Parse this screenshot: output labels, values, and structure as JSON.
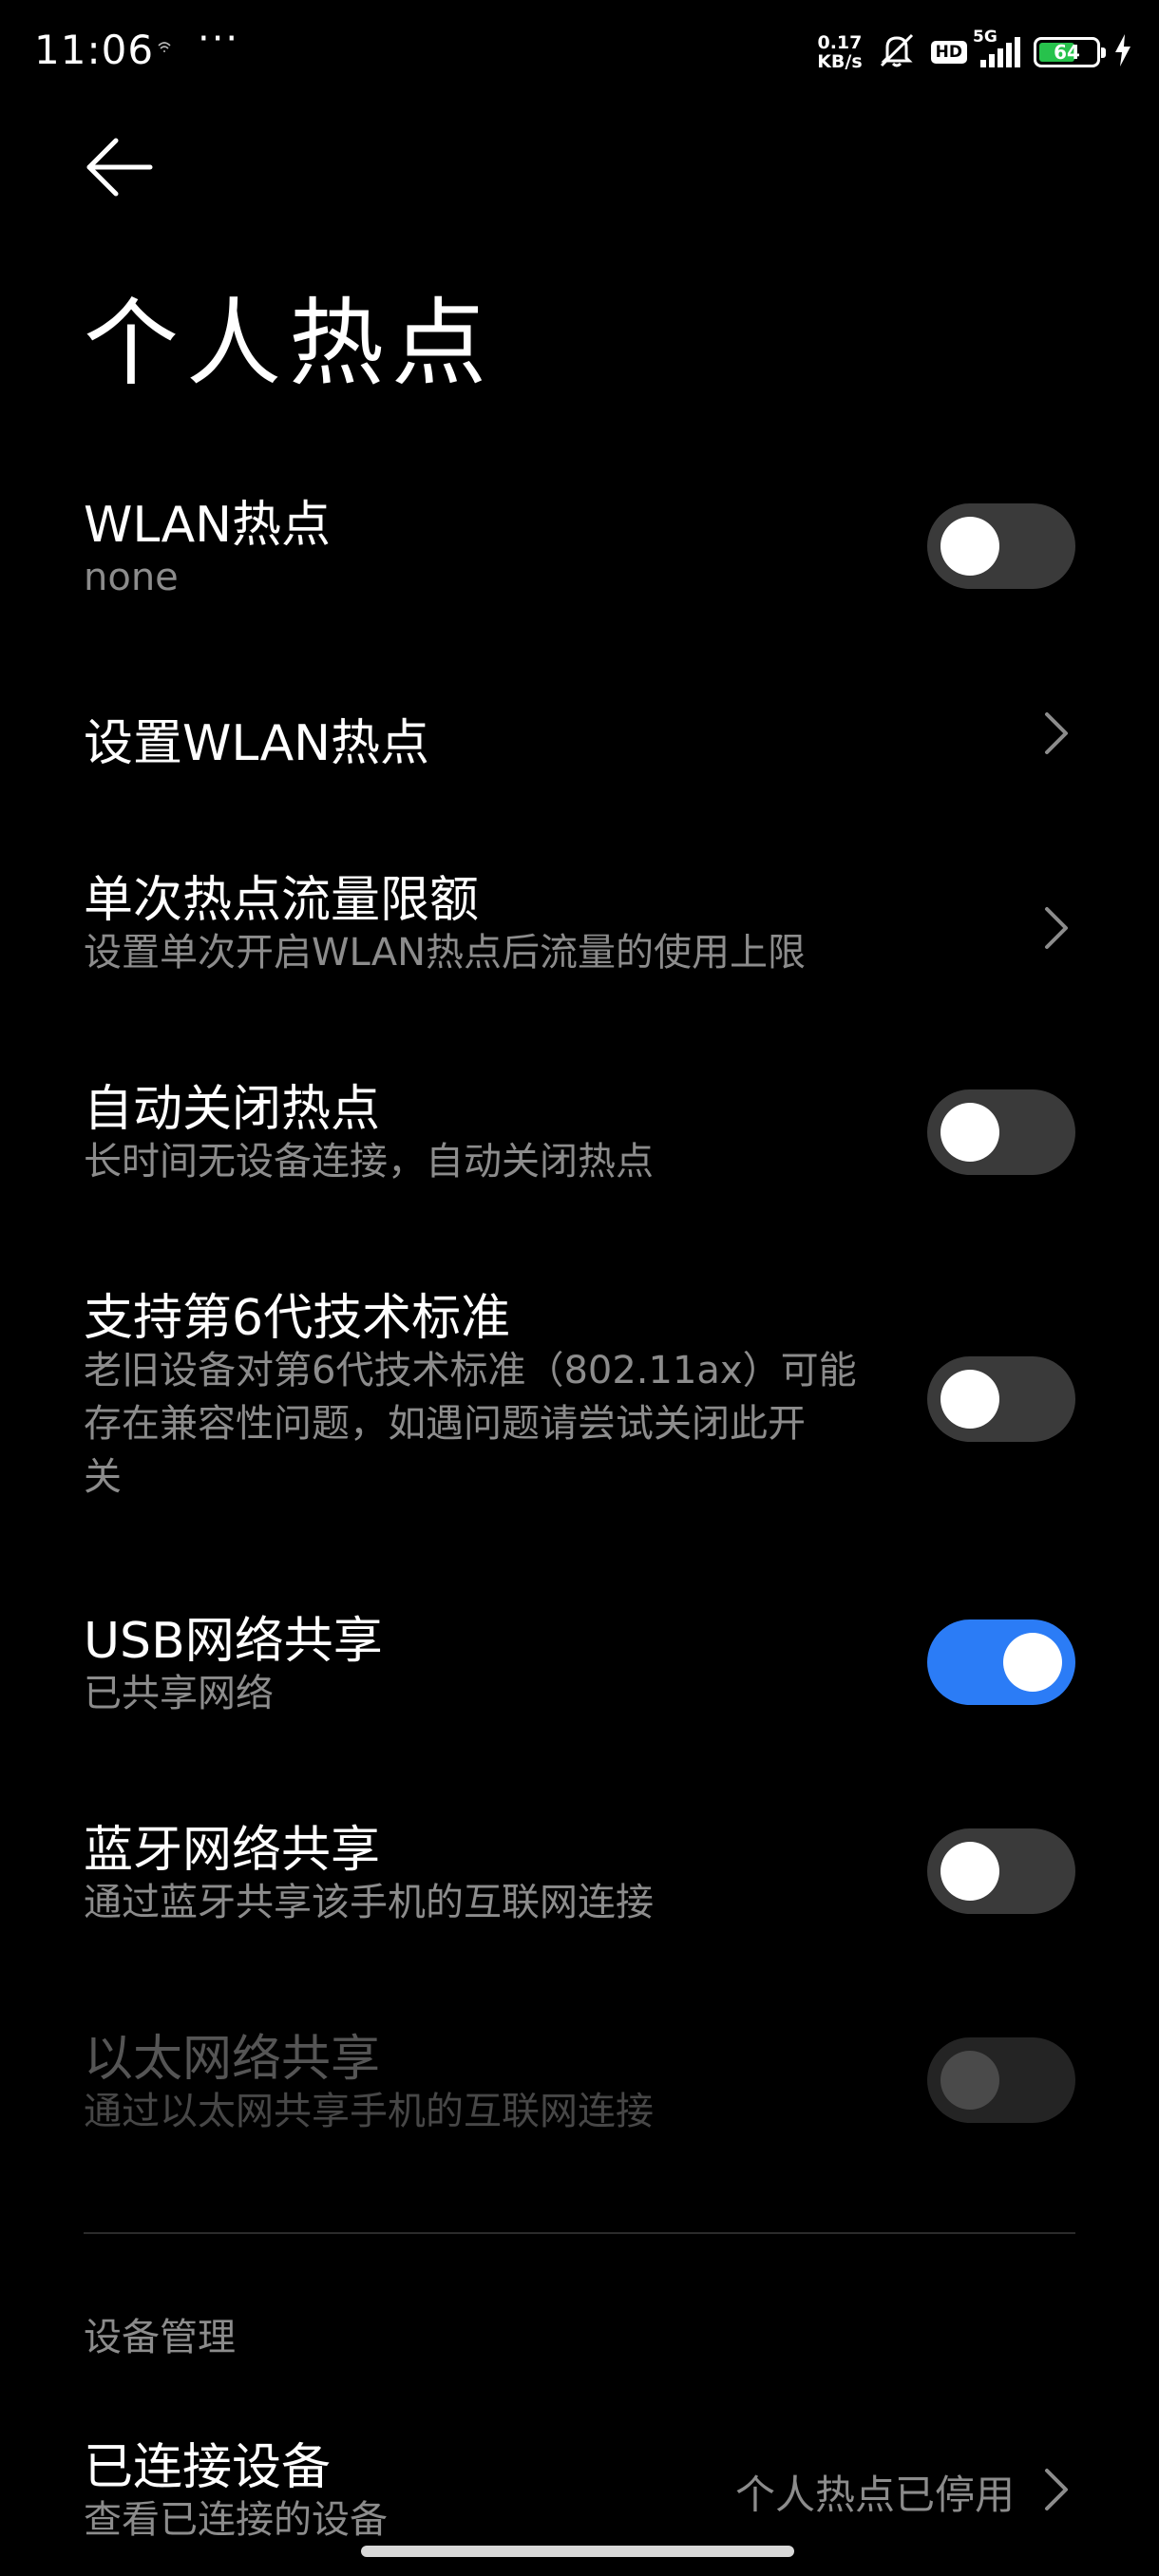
{
  "status_bar": {
    "time": "11:06",
    "dots": "···",
    "net_speed_value": "0.17",
    "net_speed_unit": "KB/s",
    "hd_label": "HD",
    "network_type": "5G",
    "battery_level": "64",
    "battery_fraction": 0.64,
    "icons": [
      "wifi-small-icon",
      "more-dots-icon",
      "muted-bell-icon",
      "hd-icon",
      "signal-icon",
      "battery-icon",
      "charging-bolt-icon"
    ]
  },
  "header": {
    "back_icon": "arrow-left-icon",
    "title": "个人热点"
  },
  "settings": {
    "wlan_hotspot": {
      "title": "WLAN热点",
      "subtitle": "none",
      "enabled": false
    },
    "setup_wlan_hotspot": {
      "title": "设置WLAN热点"
    },
    "data_limit": {
      "title": "单次热点流量限额",
      "subtitle": "设置单次开启WLAN热点后流量的使用上限"
    },
    "auto_off": {
      "title": "自动关闭热点",
      "subtitle": "长时间无设备连接，自动关闭热点",
      "enabled": false
    },
    "wifi6": {
      "title": "支持第6代技术标准",
      "subtitle_lines": [
        "老旧设备对第6代技术标准（802.11ax）可能",
        "存在兼容性问题，如遇问题请尝试关闭此开",
        "关"
      ],
      "enabled": false
    },
    "usb_tethering": {
      "title": "USB网络共享",
      "subtitle": "已共享网络",
      "enabled": true
    },
    "bluetooth_tethering": {
      "title": "蓝牙网络共享",
      "subtitle": "通过蓝牙共享该手机的互联网连接",
      "enabled": false
    },
    "ethernet_tethering": {
      "title": "以太网络共享",
      "subtitle": "通过以太网共享手机的互联网连接",
      "enabled": false,
      "disabled": true
    }
  },
  "device_management": {
    "section_title": "设备管理",
    "connected_devices": {
      "title": "已连接设备",
      "subtitle": "查看已连接的设备",
      "value": "个人热点已停用"
    }
  },
  "colors": {
    "background": "#000000",
    "toggle_on": "#2b7cf6",
    "toggle_off": "#3a3a3a",
    "secondary_text": "#8c8c8c",
    "battery": "#27c24c"
  }
}
